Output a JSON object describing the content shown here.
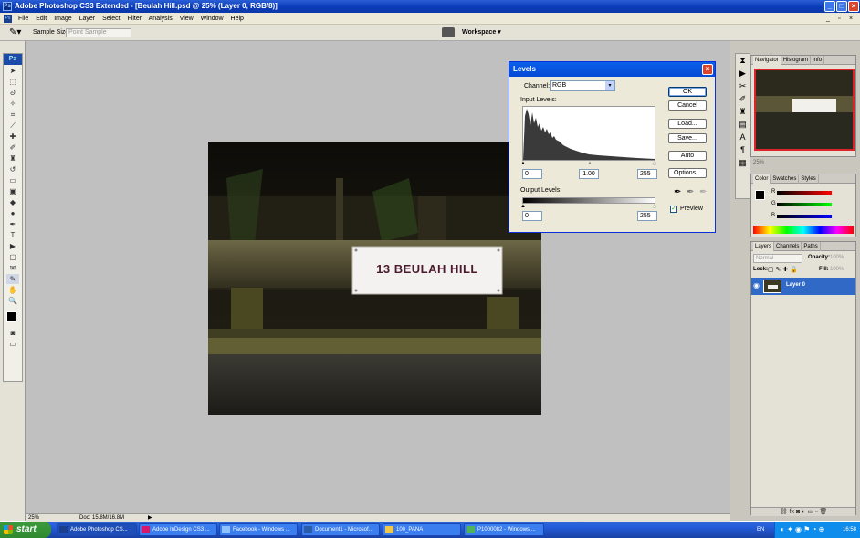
{
  "window": {
    "title": "Adobe Photoshop CS3 Extended - [Beulah Hill.psd @ 25% (Layer 0, RGB/8)]"
  },
  "menu": [
    "File",
    "Edit",
    "Image",
    "Layer",
    "Select",
    "Filter",
    "Analysis",
    "View",
    "Window",
    "Help"
  ],
  "options": {
    "sample_size_label": "Sample Size:",
    "sample_size_value": "Point Sample",
    "workspace_label": "Workspace ▾"
  },
  "photo": {
    "sign_text": "13 BEULAH HILL"
  },
  "levels": {
    "title": "Levels",
    "channel_label": "Channel:",
    "channel_value": "RGB",
    "input_levels_label": "Input Levels:",
    "input_black": "0",
    "input_gamma": "1.00",
    "input_white": "255",
    "output_levels_label": "Output Levels:",
    "output_black": "0",
    "output_white": "255",
    "buttons": {
      "ok": "OK",
      "cancel": "Cancel",
      "load": "Load...",
      "save": "Save...",
      "auto": "Auto",
      "options": "Options..."
    },
    "preview_label": "Preview",
    "preview_checked": true
  },
  "status": {
    "zoom": "25%",
    "doc": "Doc: 15.8M/16.8M"
  },
  "navigator": {
    "tabs": [
      "Navigator",
      "Histogram",
      "Info"
    ],
    "zoom": "25%"
  },
  "color": {
    "tabs": [
      "Color",
      "Swatches",
      "Styles"
    ],
    "r": "R",
    "g": "G",
    "b": "B"
  },
  "layers": {
    "tabs": [
      "Layers",
      "Channels",
      "Paths"
    ],
    "blend_mode": "Normal",
    "opacity_label": "Opacity:",
    "opacity_value": "100%",
    "lock_label": "Lock:",
    "fill_label": "Fill:",
    "fill_value": "100%",
    "layer_name": "Layer 0"
  },
  "taskbar": {
    "start_label": "start",
    "tasks": [
      "Adobe Photoshop CS...",
      "Adobe InDesign CS3 ...",
      "Facebook - Windows ...",
      "Document1 - Microsof...",
      "100_PANA",
      "P1000082 - Windows ..."
    ],
    "language": "EN",
    "clock": "16:58"
  }
}
